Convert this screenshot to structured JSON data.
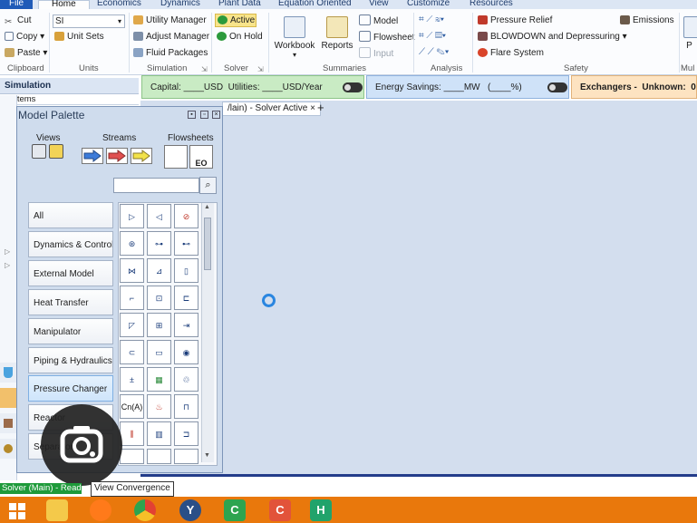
{
  "menu": {
    "tabs": [
      "File",
      "Home",
      "Economics",
      "Dynamics",
      "Plant Data",
      "Equation Oriented",
      "View",
      "Customize",
      "Resources"
    ]
  },
  "ribbon": {
    "clipboard": {
      "cut": "Cut",
      "copy": "Copy",
      "paste": "Paste",
      "label": "Clipboard"
    },
    "units": {
      "unit_set_value": "SI",
      "unit_sets": "Unit Sets",
      "label": "Units"
    },
    "simulation": {
      "utility_manager": "Utility Manager",
      "adjust_manager": "Adjust Manager",
      "fluid_packages": "Fluid Packages",
      "label": "Simulation"
    },
    "solver": {
      "active": "Active",
      "on_hold": "On Hold",
      "label": "Solver"
    },
    "summaries": {
      "workbook": "Workbook",
      "reports": "Reports",
      "model": "Model",
      "flowsheet": "Flowsheet",
      "input": "Input",
      "label": "Summaries"
    },
    "analysis": {
      "label": "Analysis"
    },
    "safety": {
      "pressure_relief": "Pressure Relief",
      "blowdown": "BLOWDOWN and Depressuring",
      "flare_system": "Flare System",
      "label": "Safety"
    },
    "emissions": "Emissions",
    "more_label": "Mul",
    "cut_off_button": "P"
  },
  "simulation_panel": {
    "title": "Simulation",
    "filter": "All Items"
  },
  "banners": {
    "capital": "Capital: ____USD",
    "utilities": "Utilities: ____USD/Year",
    "energy": "Energy Savings: ____MW",
    "energy_pct": "(____%)",
    "exchangers": "Exchangers -",
    "unknown": "Unknown:",
    "unknown_value": "0",
    "overflow": "O"
  },
  "document_tab": {
    "label": "/lain) - Solver Active",
    "close": "×",
    "new": "+"
  },
  "palette": {
    "title": "Model Palette",
    "views_label": "Views",
    "streams_label": "Streams",
    "flowsheets_label": "Flowsheets",
    "eo_label": "EO",
    "categories": [
      "All",
      "Dynamics & Control",
      "External Model",
      "Heat Transfer",
      "Manipulator",
      "Piping & Hydraulics",
      "Pressure Changer",
      "Reactor",
      "Separator"
    ],
    "selected_category": "Pressure Changer",
    "icon_labels": {
      "cna": "Cn(A)",
      "const": "±"
    }
  },
  "status": {
    "solver": "Solver (Main) - Read",
    "view_convergence": "View Convergence"
  },
  "colors": {
    "file_tab": "#1f5bb8",
    "taskbar": "#e9780c",
    "capital_banner": "#c9ebc4",
    "energy_banner": "#cfe2f8",
    "exchanger_banner": "#fde3c1",
    "solver_active": "#f8e48a",
    "status_ok": "#1e9a3a"
  },
  "taskbar": {
    "items": [
      "windows-start",
      "file-explorer",
      "firefox",
      "chrome",
      "yahoo",
      "app-c-green",
      "app-c-red",
      "app-h"
    ]
  }
}
